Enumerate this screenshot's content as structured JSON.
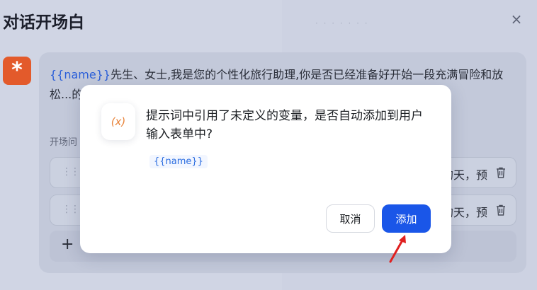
{
  "panel": {
    "title": "对话开场白",
    "faint_text": "· · · ·  · · ·",
    "close_glyph": "×"
  },
  "avatar": {
    "glyph": "*"
  },
  "prologue": {
    "variable": "{{name}}",
    "text": "先生、女士,我是您的个性化旅行助理,你是否已经准备好开始一段充满冒险和放松...的目的、预算和行程..."
  },
  "questions": {
    "label": "开场问",
    "items": [
      {
        "visible_tail": "的天，预"
      },
      {
        "visible_tail": "的天，预"
      }
    ],
    "add_glyph": "+"
  },
  "dialog": {
    "icon_text": "(x)",
    "message": "提示词中引用了未定义的变量，是否自动添加到用户输入表单中?",
    "variable_tag": "{{name}}",
    "cancel_label": "取消",
    "add_label": "添加"
  },
  "colors": {
    "accent": "#1a56e8",
    "avatar": "#e35a2b",
    "variable": "#2b5fd9",
    "annotation_arrow": "#e02020"
  }
}
